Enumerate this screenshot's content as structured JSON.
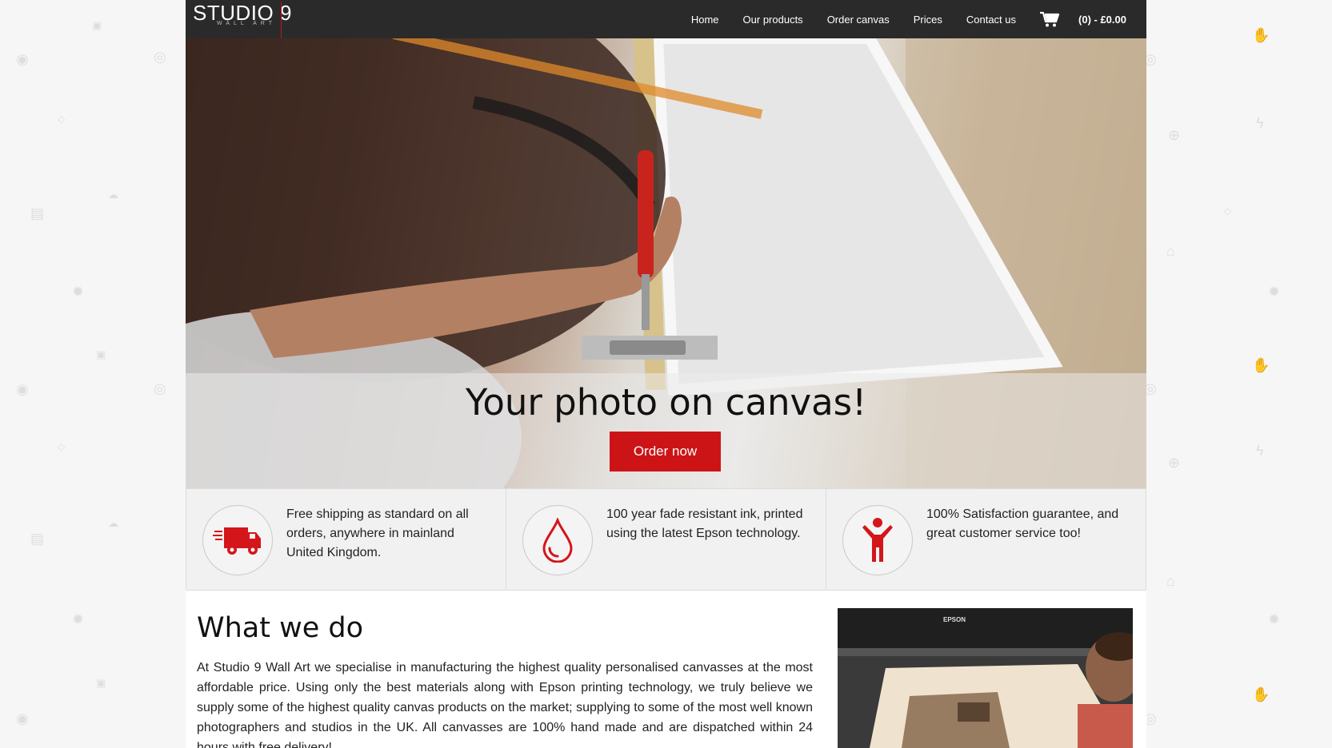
{
  "brand": {
    "logo_main": "STUDIO 9",
    "logo_sub": "WALL ART",
    "accent": "#cc1417"
  },
  "nav": {
    "items": [
      {
        "label": "Home"
      },
      {
        "label": "Our products"
      },
      {
        "label": "Order canvas"
      },
      {
        "label": "Prices"
      },
      {
        "label": "Contact us"
      }
    ],
    "cart_icon": "cart-icon",
    "cart_label": "(0) - £0.00"
  },
  "hero": {
    "title": "Your photo on canvas!",
    "cta_label": "Order now"
  },
  "features": [
    {
      "icon": "truck-icon",
      "text": "Free shipping as standard on all orders, anywhere in mainland United Kingdom."
    },
    {
      "icon": "ink-drop-icon",
      "text": "100 year fade resistant ink, printed using the latest Epson technology."
    },
    {
      "icon": "person-icon",
      "text": "100% Satisfaction guarantee, and great customer service too!"
    }
  ],
  "what_we_do": {
    "title": "What we do",
    "body": "At Studio 9 Wall Art we specialise in manufacturing the highest quality personalised canvasses at the most affordable price. Using only the best materials along with Epson printing technology, we truly believe we supply some of the highest quality canvas products on the market; supplying to some of the most well known photographers and studios in the UK. All canvasses are 100% hand made and are dispatched within 24 hours with free delivery!",
    "printer_brand": "EPSON"
  }
}
